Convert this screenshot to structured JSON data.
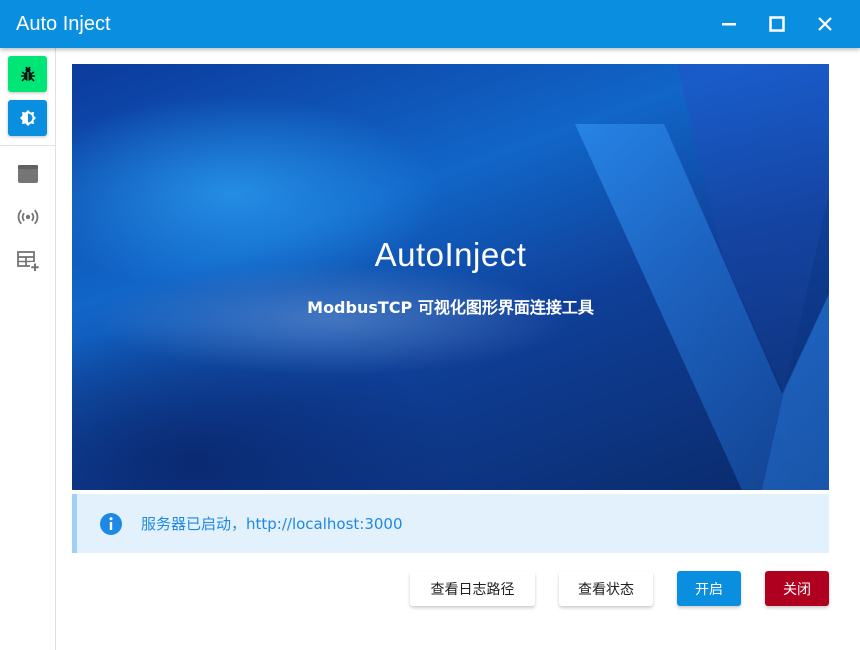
{
  "window": {
    "title": "Auto Inject",
    "controls": [
      "minimize-icon",
      "maximize-icon",
      "close-icon"
    ]
  },
  "sidebar": {
    "top_buttons": [
      {
        "icon": "bug-icon",
        "color": "#00e676"
      },
      {
        "icon": "brightness-icon",
        "color": "#0a8fe0"
      }
    ],
    "nav_items": [
      {
        "icon": "window-icon"
      },
      {
        "icon": "broadcast-icon"
      },
      {
        "icon": "table-add-icon"
      }
    ]
  },
  "banner": {
    "title": "AutoInject",
    "subtitle": "ModbusTCP 可视化图形界面连接工具"
  },
  "alert": {
    "icon": "info-icon",
    "text": "服务器已启动，http://localhost:3000"
  },
  "actions": {
    "log_path_label": "查看日志路径",
    "status_label": "查看状态",
    "start_label": "开启",
    "stop_label": "关闭"
  },
  "colors": {
    "accent": "#0a8fe0",
    "success": "#00e676",
    "danger": "#b00020",
    "info_text": "#1e88e5"
  }
}
